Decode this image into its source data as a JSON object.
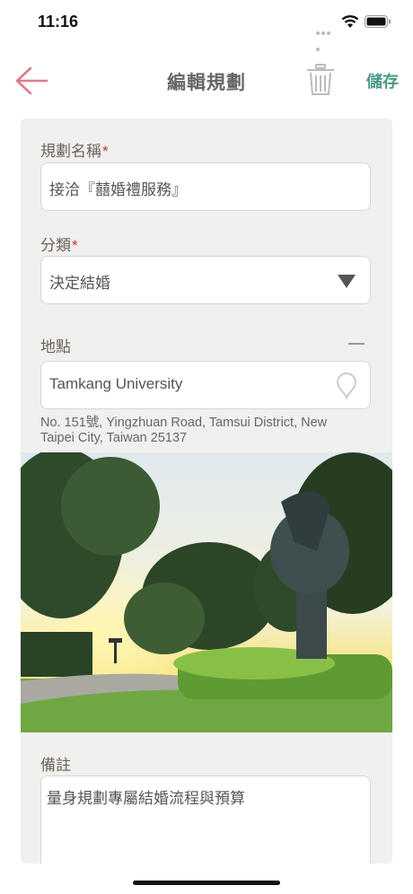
{
  "status_bar": {
    "time": "11:16"
  },
  "nav": {
    "title": "編輯規劃",
    "save_label": "儲存"
  },
  "form": {
    "name_label": "規劃名稱",
    "name_value": "接洽『囍婚禮服務』",
    "category_label": "分類",
    "category_value": "決定結婚",
    "location_label": "地點",
    "location_value": "Tamkang University",
    "address": "No. 151號, Yingzhuan Road, Tamsui District, New Taipei City, Taiwan 25137",
    "notes_label": "備註",
    "notes_value": "量身規劃專屬結婚流程與預算",
    "required_mark": "*"
  },
  "colors": {
    "accent_back": "#e07a8e",
    "save": "#4a9a86",
    "required": "#c0392b"
  },
  "icons": [
    "back-arrow-icon",
    "trash-icon",
    "dropdown-triangle-icon",
    "map-pin-icon",
    "collapse-dash-icon"
  ]
}
